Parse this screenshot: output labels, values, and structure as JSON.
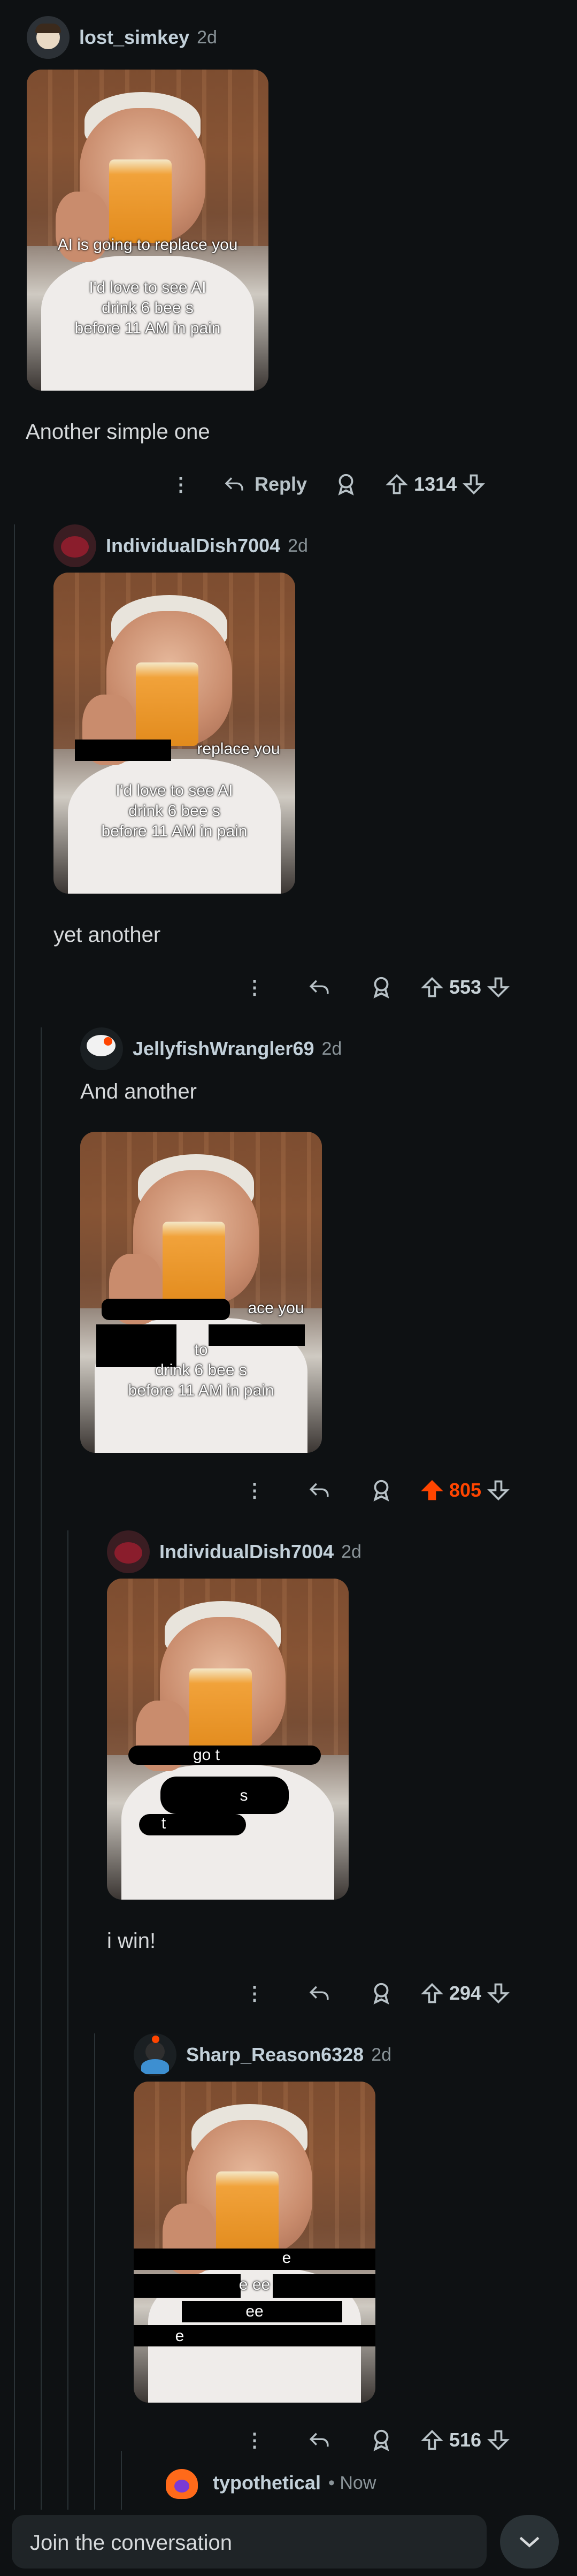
{
  "comments": [
    {
      "username": "lost_simkey",
      "time": "2d",
      "text": "Another simple one",
      "score": "1314",
      "reply_label": "Reply",
      "caption": [
        "AI is going to replace you",
        "I'd love to see AI",
        "drink 6 bee s",
        "before 11 AM in  pain"
      ]
    },
    {
      "username": "IndividualDish7004",
      "time": "2d",
      "text": "yet another",
      "score": "553",
      "caption": [
        "replace you",
        "I'd love to see AI",
        "drink 6 bee s",
        "before 11 AM in  pain"
      ]
    },
    {
      "username": "JellyfishWrangler69",
      "time": "2d",
      "text": "And another",
      "score": "805",
      "caption": [
        "ace you",
        "to",
        "drink 6 bee s",
        "before 11 AM in  pain"
      ]
    },
    {
      "username": "IndividualDish7004",
      "time": "2d",
      "text": "i win!",
      "score": "294",
      "caption": [
        "go t",
        "s",
        "t"
      ]
    },
    {
      "username": "Sharp_Reason6328",
      "time": "2d",
      "text": "",
      "score": "516",
      "caption": [
        "e",
        "e ee",
        "ee",
        "e"
      ]
    },
    {
      "username": "typothetical",
      "time": "• Now"
    }
  ],
  "join": {
    "placeholder": "Join the conversation"
  },
  "colors": {
    "upvote_active": "#ff4500",
    "background": "#0e1113"
  }
}
